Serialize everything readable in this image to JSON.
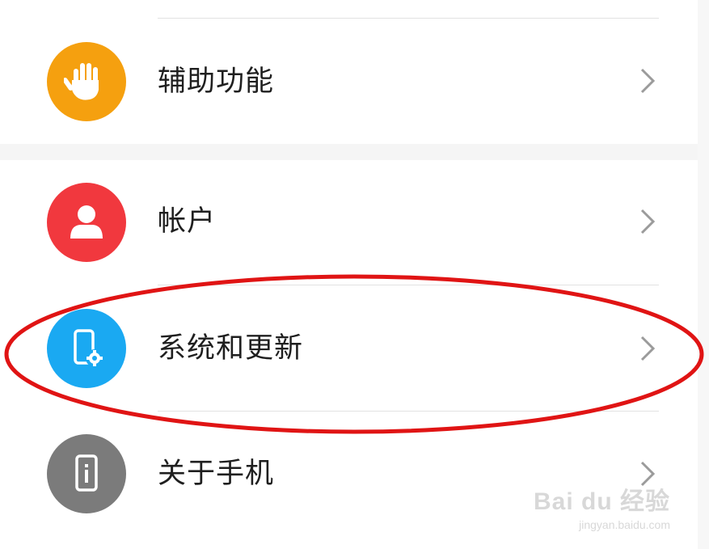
{
  "settings": {
    "items": [
      {
        "label": "辅助功能",
        "icon": "hand-icon",
        "color": "#f5a00f"
      },
      {
        "label": "帐户",
        "icon": "person-icon",
        "color": "#f1383e"
      },
      {
        "label": "系统和更新",
        "icon": "phone-settings-icon",
        "color": "#1aa9f2"
      },
      {
        "label": "关于手机",
        "icon": "phone-info-icon",
        "color": "#7b7b7b"
      }
    ]
  },
  "annotation": {
    "color": "#e01414"
  },
  "watermark": {
    "brand": "Bai du 经验",
    "url": "jingyan.baidu.com"
  }
}
